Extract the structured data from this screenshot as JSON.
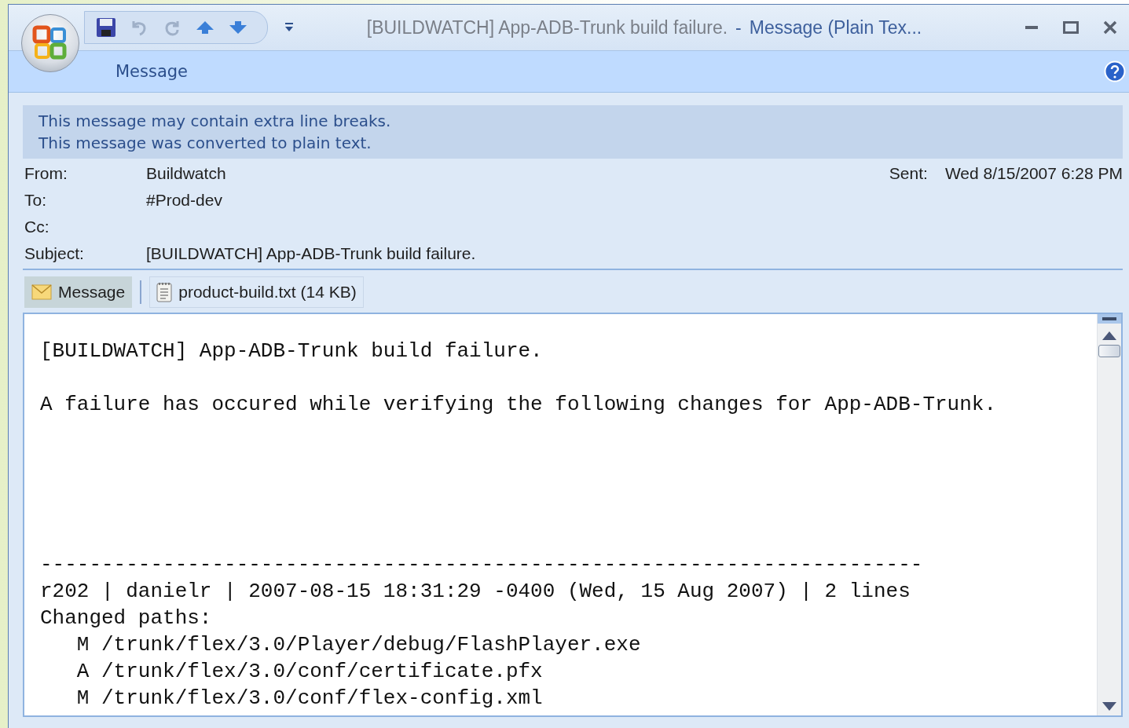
{
  "window": {
    "title_subject": "[BUILDWATCH] App-ADB-Trunk build failure.",
    "title_separator": "-",
    "title_app": "Message (Plain Tex..."
  },
  "ribbon": {
    "tabs": [
      {
        "label": "Message",
        "selected": true
      }
    ]
  },
  "infobar": {
    "lines": [
      "This message may contain extra line breaks.",
      "This message was converted to plain text."
    ]
  },
  "header": {
    "fields": [
      {
        "label": "From:",
        "value": "Buildwatch"
      },
      {
        "label": "To:",
        "value": "#Prod-dev"
      },
      {
        "label": "Cc:"
      },
      {
        "label": "Subject:",
        "value": "[BUILDWATCH] App-ADB-Trunk build failure."
      }
    ],
    "sent_label": "Sent:",
    "sent_value": "Wed 8/15/2007 6:28 PM"
  },
  "attachments": [
    {
      "kind": "message",
      "label": "Message",
      "selected": true
    },
    {
      "kind": "file",
      "label": "product-build.txt (14 KB)",
      "selected": false
    }
  ],
  "body": {
    "lines": [
      {
        "kind": "heading",
        "text": "[BUILDWATCH] App-ADB-Trunk build failure."
      },
      {
        "kind": "text",
        "text": "A failure has occured while verifying the following changes for App-ADB-Trunk."
      },
      {
        "kind": "rule",
        "text": "------------------------------------------------------------------------"
      },
      {
        "kind": "log",
        "text": "r202 | danielr | 2007-08-15 18:31:29 -0400 (Wed, 15 Aug 2007) | 2 lines"
      },
      {
        "kind": "log",
        "text": "Changed paths:"
      },
      {
        "kind": "log",
        "text": "   M /trunk/flex/3.0/Player/debug/FlashPlayer.exe"
      },
      {
        "kind": "log",
        "text": "   A /trunk/flex/3.0/conf/certificate.pfx"
      },
      {
        "kind": "log",
        "text": "   M /trunk/flex/3.0/conf/flex-config.xml"
      }
    ]
  }
}
